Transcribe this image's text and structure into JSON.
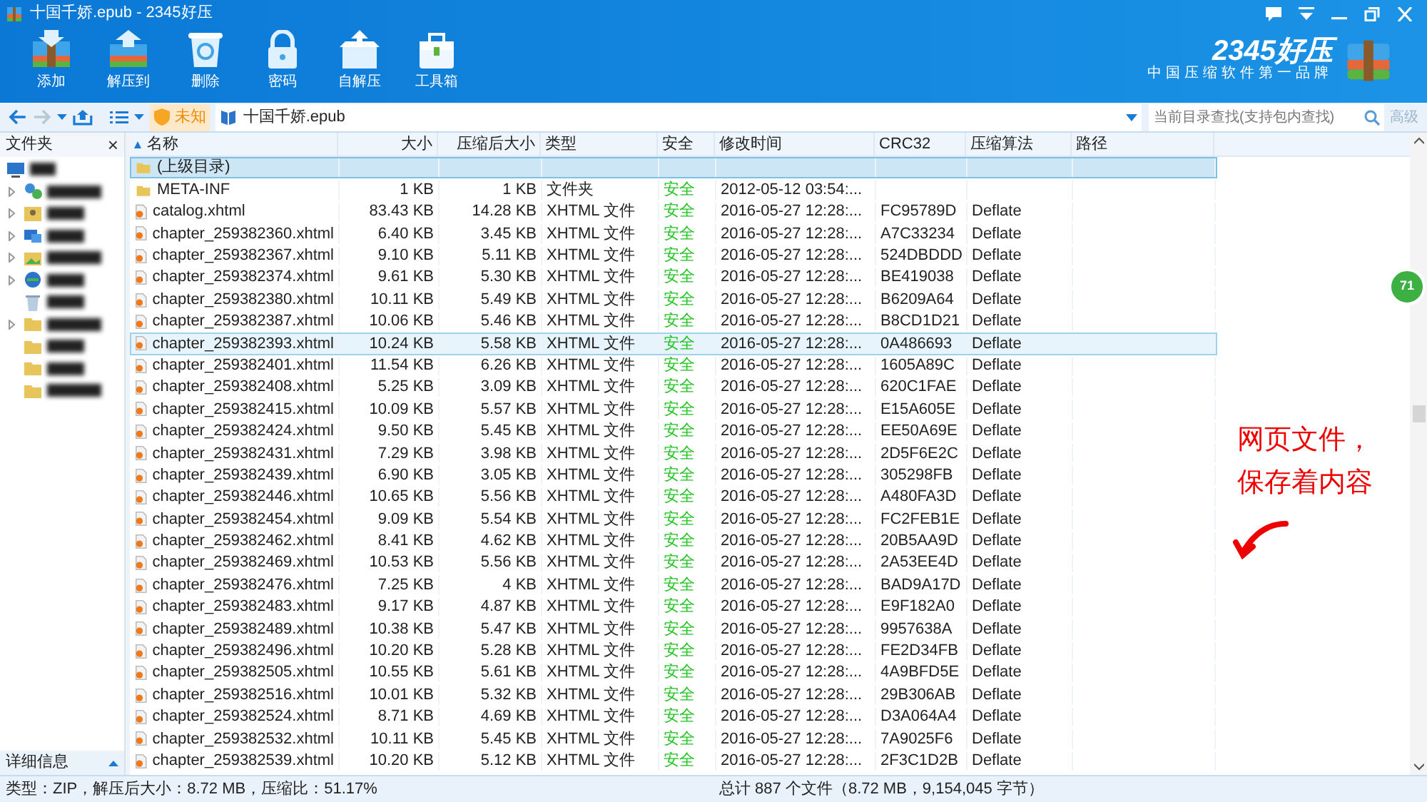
{
  "window": {
    "title": "十国千娇.epub - 2345好压"
  },
  "brand": {
    "name": "2345好压",
    "slogan": "中国压缩软件第一品牌"
  },
  "toolbar": [
    "添加",
    "解压到",
    "删除",
    "密码",
    "自解压",
    "工具箱"
  ],
  "address_bar": {
    "security": "未知",
    "path": "十国千娇.epub",
    "forward_disabled": true
  },
  "search": {
    "placeholder": "当前目录查找(支持包内查找)",
    "advanced": "高级"
  },
  "sidebar": {
    "title": "文件夹",
    "close": "×",
    "details": "详细信息",
    "tree": {
      "kind": "desktop",
      "children": [
        {
          "kind": "network",
          "expandable": true
        },
        {
          "kind": "user",
          "expandable": true
        },
        {
          "kind": "computer",
          "expandable": true
        },
        {
          "kind": "picture",
          "expandable": true
        },
        {
          "kind": "globe",
          "expandable": true
        },
        {
          "kind": "recycle",
          "expandable": false
        },
        {
          "kind": "folder",
          "expandable": true
        },
        {
          "kind": "folder",
          "expandable": false
        },
        {
          "kind": "folder",
          "expandable": false
        },
        {
          "kind": "folder",
          "expandable": false
        }
      ]
    }
  },
  "table": {
    "columns": [
      "名称",
      "大小",
      "压缩后大小",
      "类型",
      "安全",
      "修改时间",
      "CRC32",
      "压缩算法",
      "路径"
    ],
    "rows": [
      {
        "kind": "parent",
        "selected": true,
        "hovered": false,
        "cells": [
          "(上级目录)",
          "",
          "",
          "",
          "",
          "",
          "",
          "",
          ""
        ]
      },
      {
        "kind": "folder",
        "selected": false,
        "hovered": false,
        "cells": [
          "META-INF",
          "1 KB",
          "1 KB",
          "文件夹",
          "安全",
          "2012-05-12 03:54:...",
          "",
          "",
          ""
        ]
      },
      {
        "kind": "file",
        "selected": false,
        "hovered": false,
        "cells": [
          "catalog.xhtml",
          "83.43 KB",
          "14.28 KB",
          "XHTML 文件",
          "安全",
          "2016-05-27 12:28:...",
          "FC95789D",
          "Deflate",
          ""
        ]
      },
      {
        "kind": "file",
        "selected": false,
        "hovered": false,
        "cells": [
          "chapter_259382360.xhtml",
          "6.40 KB",
          "3.45 KB",
          "XHTML 文件",
          "安全",
          "2016-05-27 12:28:...",
          "A7C33234",
          "Deflate",
          ""
        ]
      },
      {
        "kind": "file",
        "selected": false,
        "hovered": false,
        "cells": [
          "chapter_259382367.xhtml",
          "9.10 KB",
          "5.11 KB",
          "XHTML 文件",
          "安全",
          "2016-05-27 12:28:...",
          "524DBDDD",
          "Deflate",
          ""
        ]
      },
      {
        "kind": "file",
        "selected": false,
        "hovered": false,
        "cells": [
          "chapter_259382374.xhtml",
          "9.61 KB",
          "5.30 KB",
          "XHTML 文件",
          "安全",
          "2016-05-27 12:28:...",
          "BE419038",
          "Deflate",
          ""
        ]
      },
      {
        "kind": "file",
        "selected": false,
        "hovered": false,
        "cells": [
          "chapter_259382380.xhtml",
          "10.11 KB",
          "5.49 KB",
          "XHTML 文件",
          "安全",
          "2016-05-27 12:28:...",
          "B6209A64",
          "Deflate",
          ""
        ]
      },
      {
        "kind": "file",
        "selected": false,
        "hovered": false,
        "cells": [
          "chapter_259382387.xhtml",
          "10.06 KB",
          "5.46 KB",
          "XHTML 文件",
          "安全",
          "2016-05-27 12:28:...",
          "B8CD1D21",
          "Deflate",
          ""
        ]
      },
      {
        "kind": "file",
        "selected": false,
        "hovered": true,
        "cells": [
          "chapter_259382393.xhtml",
          "10.24 KB",
          "5.58 KB",
          "XHTML 文件",
          "安全",
          "2016-05-27 12:28:...",
          "0A486693",
          "Deflate",
          ""
        ]
      },
      {
        "kind": "file",
        "selected": false,
        "hovered": false,
        "cells": [
          "chapter_259382401.xhtml",
          "11.54 KB",
          "6.26 KB",
          "XHTML 文件",
          "安全",
          "2016-05-27 12:28:...",
          "1605A89C",
          "Deflate",
          ""
        ]
      },
      {
        "kind": "file",
        "selected": false,
        "hovered": false,
        "cells": [
          "chapter_259382408.xhtml",
          "5.25 KB",
          "3.09 KB",
          "XHTML 文件",
          "安全",
          "2016-05-27 12:28:...",
          "620C1FAE",
          "Deflate",
          ""
        ]
      },
      {
        "kind": "file",
        "selected": false,
        "hovered": false,
        "cells": [
          "chapter_259382415.xhtml",
          "10.09 KB",
          "5.57 KB",
          "XHTML 文件",
          "安全",
          "2016-05-27 12:28:...",
          "E15A605E",
          "Deflate",
          ""
        ]
      },
      {
        "kind": "file",
        "selected": false,
        "hovered": false,
        "cells": [
          "chapter_259382424.xhtml",
          "9.50 KB",
          "5.45 KB",
          "XHTML 文件",
          "安全",
          "2016-05-27 12:28:...",
          "EE50A69E",
          "Deflate",
          ""
        ]
      },
      {
        "kind": "file",
        "selected": false,
        "hovered": false,
        "cells": [
          "chapter_259382431.xhtml",
          "7.29 KB",
          "3.98 KB",
          "XHTML 文件",
          "安全",
          "2016-05-27 12:28:...",
          "2D5F6E2C",
          "Deflate",
          ""
        ]
      },
      {
        "kind": "file",
        "selected": false,
        "hovered": false,
        "cells": [
          "chapter_259382439.xhtml",
          "6.90 KB",
          "3.05 KB",
          "XHTML 文件",
          "安全",
          "2016-05-27 12:28:...",
          "305298FB",
          "Deflate",
          ""
        ]
      },
      {
        "kind": "file",
        "selected": false,
        "hovered": false,
        "cells": [
          "chapter_259382446.xhtml",
          "10.65 KB",
          "5.56 KB",
          "XHTML 文件",
          "安全",
          "2016-05-27 12:28:...",
          "A480FA3D",
          "Deflate",
          ""
        ]
      },
      {
        "kind": "file",
        "selected": false,
        "hovered": false,
        "cells": [
          "chapter_259382454.xhtml",
          "9.09 KB",
          "5.54 KB",
          "XHTML 文件",
          "安全",
          "2016-05-27 12:28:...",
          "FC2FEB1E",
          "Deflate",
          ""
        ]
      },
      {
        "kind": "file",
        "selected": false,
        "hovered": false,
        "cells": [
          "chapter_259382462.xhtml",
          "8.41 KB",
          "4.62 KB",
          "XHTML 文件",
          "安全",
          "2016-05-27 12:28:...",
          "20B5AA9D",
          "Deflate",
          ""
        ]
      },
      {
        "kind": "file",
        "selected": false,
        "hovered": false,
        "cells": [
          "chapter_259382469.xhtml",
          "10.53 KB",
          "5.56 KB",
          "XHTML 文件",
          "安全",
          "2016-05-27 12:28:...",
          "2A53EE4D",
          "Deflate",
          ""
        ]
      },
      {
        "kind": "file",
        "selected": false,
        "hovered": false,
        "cells": [
          "chapter_259382476.xhtml",
          "7.25 KB",
          "4 KB",
          "XHTML 文件",
          "安全",
          "2016-05-27 12:28:...",
          "BAD9A17D",
          "Deflate",
          ""
        ]
      },
      {
        "kind": "file",
        "selected": false,
        "hovered": false,
        "cells": [
          "chapter_259382483.xhtml",
          "9.17 KB",
          "4.87 KB",
          "XHTML 文件",
          "安全",
          "2016-05-27 12:28:...",
          "E9F182A0",
          "Deflate",
          ""
        ]
      },
      {
        "kind": "file",
        "selected": false,
        "hovered": false,
        "cells": [
          "chapter_259382489.xhtml",
          "10.38 KB",
          "5.47 KB",
          "XHTML 文件",
          "安全",
          "2016-05-27 12:28:...",
          "9957638A",
          "Deflate",
          ""
        ]
      },
      {
        "kind": "file",
        "selected": false,
        "hovered": false,
        "cells": [
          "chapter_259382496.xhtml",
          "10.20 KB",
          "5.28 KB",
          "XHTML 文件",
          "安全",
          "2016-05-27 12:28:...",
          "FE2D34FB",
          "Deflate",
          ""
        ]
      },
      {
        "kind": "file",
        "selected": false,
        "hovered": false,
        "cells": [
          "chapter_259382505.xhtml",
          "10.55 KB",
          "5.61 KB",
          "XHTML 文件",
          "安全",
          "2016-05-27 12:28:...",
          "4A9BFD5E",
          "Deflate",
          ""
        ]
      },
      {
        "kind": "file",
        "selected": false,
        "hovered": false,
        "cells": [
          "chapter_259382516.xhtml",
          "10.01 KB",
          "5.32 KB",
          "XHTML 文件",
          "安全",
          "2016-05-27 12:28:...",
          "29B306AB",
          "Deflate",
          ""
        ]
      },
      {
        "kind": "file",
        "selected": false,
        "hovered": false,
        "cells": [
          "chapter_259382524.xhtml",
          "8.71 KB",
          "4.69 KB",
          "XHTML 文件",
          "安全",
          "2016-05-27 12:28:...",
          "D3A064A4",
          "Deflate",
          ""
        ]
      },
      {
        "kind": "file",
        "selected": false,
        "hovered": false,
        "cells": [
          "chapter_259382532.xhtml",
          "10.11 KB",
          "5.45 KB",
          "XHTML 文件",
          "安全",
          "2016-05-27 12:28:...",
          "7A9025F6",
          "Deflate",
          ""
        ]
      },
      {
        "kind": "file",
        "selected": false,
        "hovered": false,
        "cells": [
          "chapter_259382539.xhtml",
          "10.20 KB",
          "5.12 KB",
          "XHTML 文件",
          "安全",
          "2016-05-27 12:28:...",
          "2F3C1D2B",
          "Deflate",
          ""
        ]
      }
    ]
  },
  "floating_badge": "71",
  "annotation": "网页文件，保存着内容",
  "status_bar": {
    "left": "类型：ZIP，解压后大小：8.72 MB，压缩比：51.17%",
    "center": "总计 887 个文件（8.72 MB，9,154,045 字节）"
  }
}
